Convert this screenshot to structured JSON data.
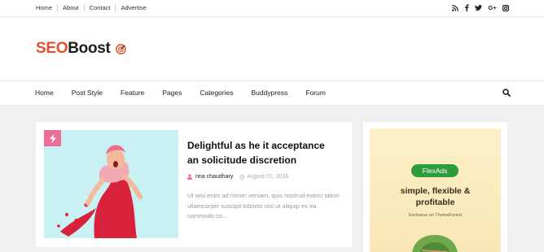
{
  "topbar": {
    "links": [
      "Home",
      "About",
      "Contact",
      "Advertise"
    ],
    "social_icons": [
      "rss-icon",
      "facebook-icon",
      "twitter-icon",
      "google-plus-icon",
      "instagram-icon"
    ]
  },
  "logo": {
    "part1": "SEO",
    "part2": "Boost"
  },
  "nav": {
    "items": [
      "Home",
      "Post Style",
      "Feature",
      "Pages",
      "Categories",
      "Buddypress",
      "Forum"
    ]
  },
  "post": {
    "title": "Delightful as he it acceptance an solicitude discretion",
    "author": "rina chaudhary",
    "date": "August 01, 2016",
    "excerpt": "Ut wisi enim ad minim veniam, quis nostrud exerci tation ullamcorper suscipit lobortis nisl ut aliquip ex ea commodo co...",
    "badge_color": "#e96f94"
  },
  "ad": {
    "pill": "FlexAds",
    "headline_line1": "simple, flexible &",
    "headline_line2": "profitable",
    "sub": "Exclusive on ThemeForest"
  },
  "colors": {
    "brand": "#e2502f",
    "accent_green": "#2e9c3a"
  }
}
